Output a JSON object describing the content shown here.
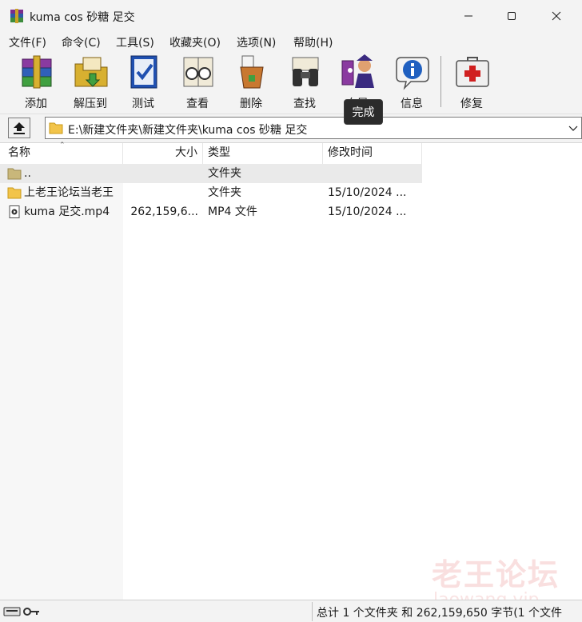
{
  "window": {
    "title": "kuma cos 砂糖 足交",
    "icon": "winrar-books-icon"
  },
  "menu": [
    "文件(F)",
    "命令(C)",
    "工具(S)",
    "收藏夹(O)",
    "选项(N)",
    "帮助(H)"
  ],
  "toolbar": {
    "add": "添加",
    "extract": "解压到",
    "test": "测试",
    "view": "查看",
    "delete": "删除",
    "find": "查找",
    "wizard": "向导",
    "info": "信息",
    "repair": "修复"
  },
  "tooltip": "完成",
  "address": {
    "path": "E:\\新建文件夹\\新建文件夹\\kuma cos 砂糖 足交"
  },
  "columns": {
    "name": "名称",
    "size": "大小",
    "type": "类型",
    "modified": "修改时间"
  },
  "files": [
    {
      "name": "..",
      "size": "",
      "type": "文件夹",
      "modified": "",
      "icon": "parent-folder-icon"
    },
    {
      "name": "上老王论坛当老王",
      "size": "",
      "type": "文件夹",
      "modified": "15/10/2024 ...",
      "icon": "folder-icon"
    },
    {
      "name": "kuma 足交.mp4",
      "size": "262,159,6...",
      "type": "MP4 文件",
      "modified": "15/10/2024 ...",
      "icon": "video-file-icon"
    }
  ],
  "status": {
    "summary": "总计 1 个文件夹 和 262,159,650 字节(1 个文件"
  },
  "watermark": {
    "cn": "老王论坛",
    "en": "laowang.vip"
  }
}
